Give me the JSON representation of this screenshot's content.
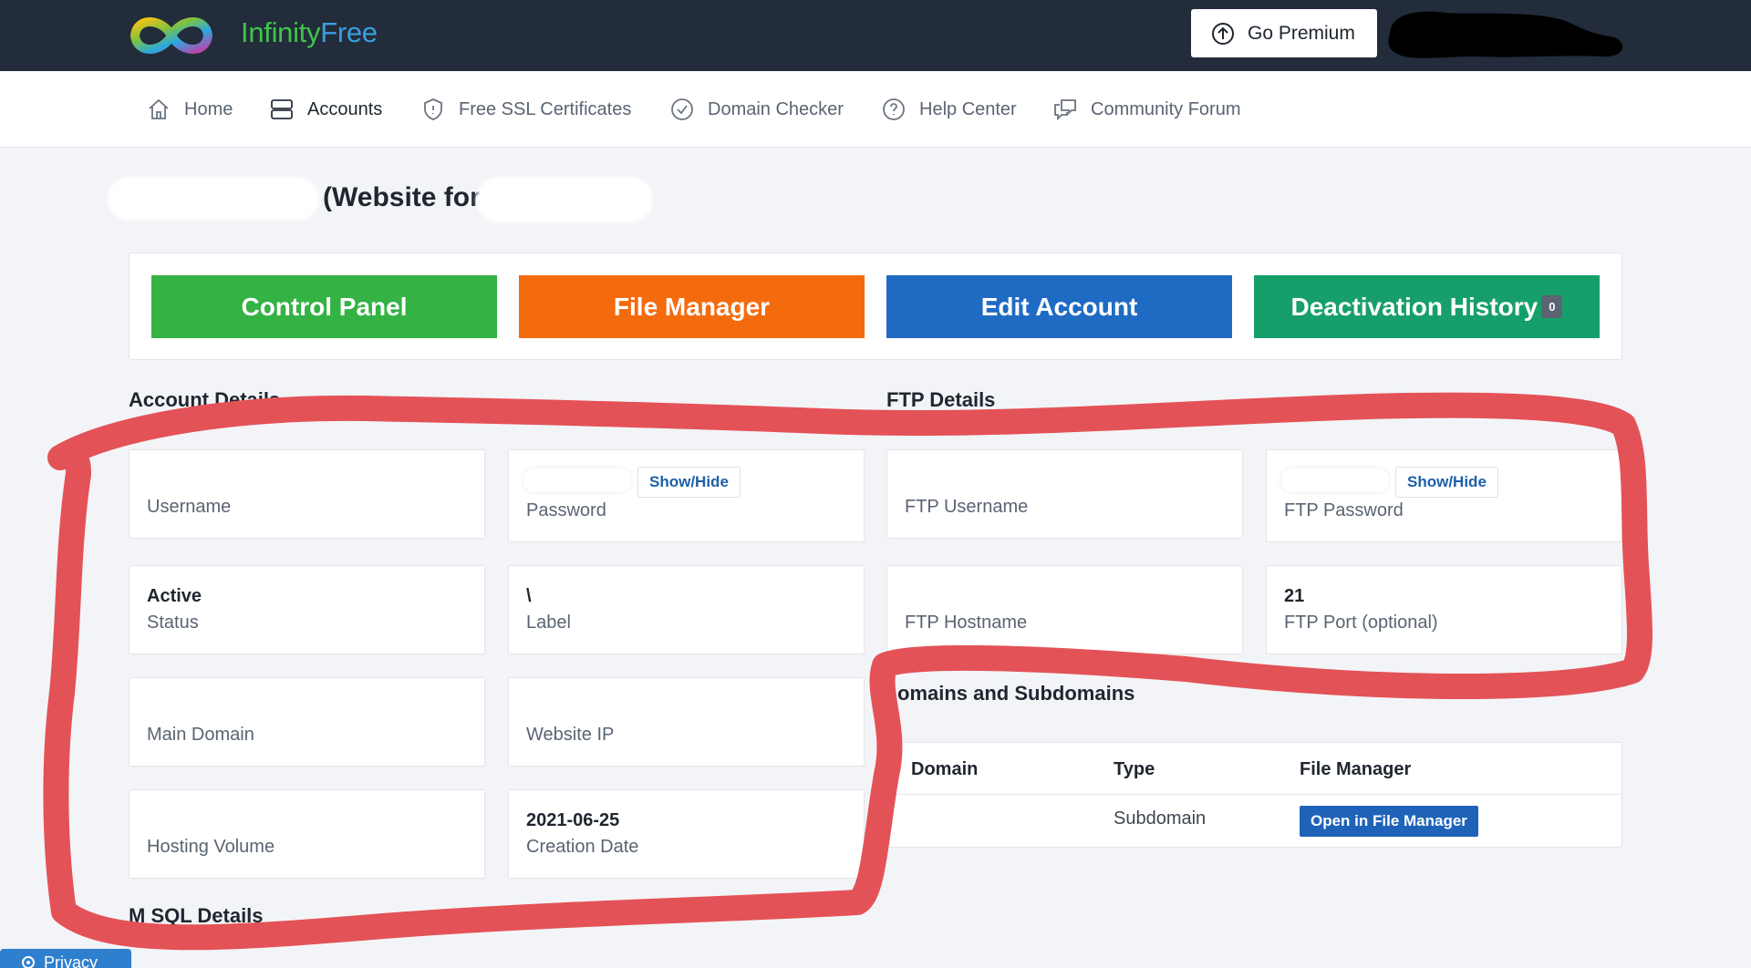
{
  "brand": {
    "word1": "Infinity",
    "word2": "Free"
  },
  "header": {
    "premium_label": "Go Premium"
  },
  "nav": {
    "items": [
      {
        "label": "Home",
        "icon": "home-icon"
      },
      {
        "label": "Accounts",
        "icon": "server-icon"
      },
      {
        "label": "Free SSL Certificates",
        "icon": "shield-icon"
      },
      {
        "label": "Domain Checker",
        "icon": "check-circle-icon"
      },
      {
        "label": "Help Center",
        "icon": "question-circle-icon"
      },
      {
        "label": "Community Forum",
        "icon": "chat-icon"
      }
    ],
    "active": "Accounts"
  },
  "page": {
    "title": "(Website for"
  },
  "actions": {
    "control_panel": "Control Panel",
    "file_manager": "File Manager",
    "edit_account": "Edit Account",
    "deactivation_history": "Deactivation History",
    "deactivation_count": "0"
  },
  "colors": {
    "control_panel": "#34b244",
    "file_manager": "#f46b0e",
    "edit_account": "#1f6bc4",
    "deactivation_history": "#169f6a",
    "annotation": "#e35257"
  },
  "account_details": {
    "heading": "Account Details",
    "username_label": "Username",
    "password_label": "Password",
    "show_hide": "Show/Hide",
    "status_value": "Active",
    "status_label": "Status",
    "label_value": "\\",
    "label_label": "Label",
    "main_domain_label": "Main Domain",
    "website_ip_label": "Website IP",
    "hosting_volume_label": "Hosting Volume",
    "creation_date_value": "2021-06-25",
    "creation_date_label": "Creation Date"
  },
  "ftp_details": {
    "heading": "FTP Details",
    "username_label": "FTP Username",
    "password_label": "FTP Password",
    "show_hide": "Show/Hide",
    "hostname_label": "FTP Hostname",
    "port_value": "21",
    "port_label": "FTP Port (optional)"
  },
  "domains": {
    "heading": "omains and Subdomains",
    "columns": [
      "Domain",
      "Type",
      "File Manager"
    ],
    "rows": [
      {
        "domain": "",
        "type": "Subdomain",
        "action": "Open in File Manager"
      }
    ]
  },
  "mysql": {
    "heading": "M SQL Details"
  },
  "privacy": {
    "label": "Privacy"
  }
}
